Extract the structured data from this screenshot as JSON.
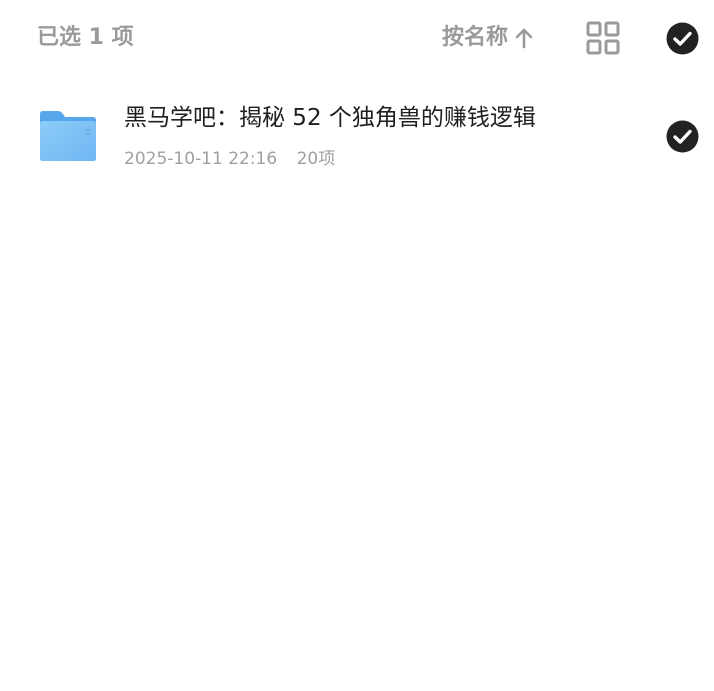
{
  "toolbar": {
    "selected_label": "已选 1 项",
    "sort_label": "按名称",
    "sort_icon": "arrow-up-icon",
    "view_icon": "grid-view-icon",
    "select_all_icon": "check-circle-icon"
  },
  "files": [
    {
      "name": "黑马学吧：揭秘 52 个独角兽的赚钱逻辑",
      "date": "2025-10-11 22:16",
      "count": "20项",
      "icon": "folder-icon",
      "selected": true
    }
  ],
  "colors": {
    "muted_text": "#9a9a9a",
    "check_fill": "#222222",
    "folder_blue": "#7cc0f5"
  }
}
